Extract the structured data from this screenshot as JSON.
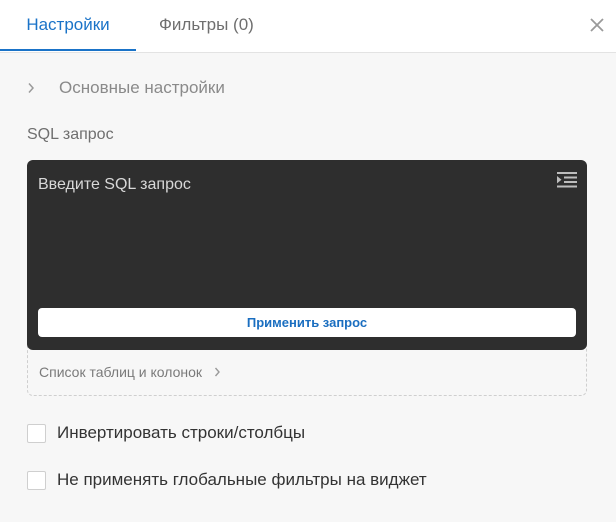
{
  "tabs": [
    {
      "label": "Настройки",
      "active": true
    },
    {
      "label": "Фильтры (0)",
      "active": false
    }
  ],
  "close_icon": "close-icon",
  "basic_settings": {
    "label": "Основные настройки",
    "icon": "chevron-right-icon"
  },
  "sql": {
    "label": "SQL запрос",
    "placeholder": "Введите SQL запрос",
    "format_icon": "format-indent-icon",
    "apply_label": "Применить запрос",
    "table_list_label": "Список таблиц и колонок"
  },
  "options": [
    {
      "label": "Инвертировать строки/столбцы",
      "checked": false
    },
    {
      "label": "Не применять глобальные фильтры на виджет",
      "checked": false
    }
  ],
  "colors": {
    "accent": "#1a73c8",
    "editor_bg": "#2e2e2e"
  }
}
